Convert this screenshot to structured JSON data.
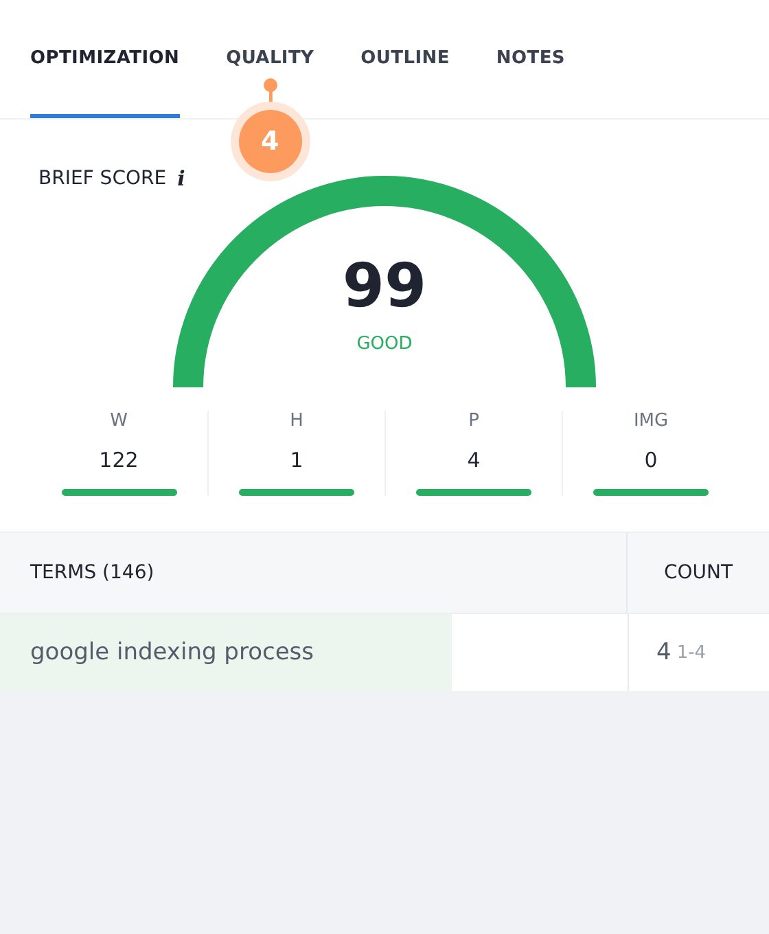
{
  "tabs": [
    {
      "label": "OPTIMIZATION",
      "selected": true
    },
    {
      "label": "QUALITY",
      "selected": false,
      "badge": "4"
    },
    {
      "label": "OUTLINE",
      "selected": false
    },
    {
      "label": "NOTES",
      "selected": false
    }
  ],
  "brief_score": {
    "label": "BRIEF SCORE",
    "info": "i",
    "score": "99",
    "rating": "GOOD"
  },
  "metrics": [
    {
      "label": "W",
      "value": "122",
      "level": 1
    },
    {
      "label": "H",
      "value": "1",
      "level": 1
    },
    {
      "label": "P",
      "value": "4",
      "level": 1
    },
    {
      "label": "IMG",
      "value": "0",
      "level": 1
    }
  ],
  "table": {
    "columns": [
      "TERMS (146)",
      "COUNT"
    ],
    "rows": [
      {
        "term": "google indexing process",
        "count": "4",
        "range": "1-4"
      }
    ]
  }
}
